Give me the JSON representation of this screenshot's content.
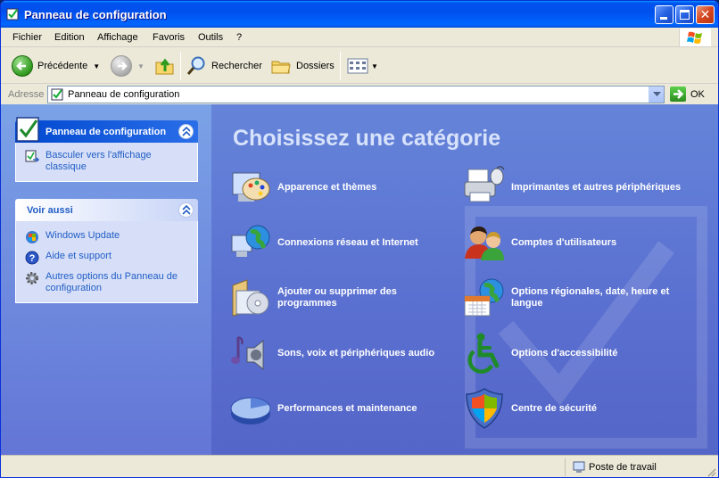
{
  "window": {
    "title": "Panneau de configuration",
    "title_icon": "control-panel-icon"
  },
  "menu": [
    {
      "label": "Fichier"
    },
    {
      "label": "Edition"
    },
    {
      "label": "Affichage"
    },
    {
      "label": "Favoris"
    },
    {
      "label": "Outils"
    },
    {
      "label": "?"
    }
  ],
  "toolbar": {
    "back_label": "Précédente",
    "search_label": "Rechercher",
    "folders_label": "Dossiers"
  },
  "address": {
    "label": "Adresse",
    "value": "Panneau de configuration",
    "go_label": "OK"
  },
  "sidebar": {
    "main_panel": {
      "title": "Panneau de configuration",
      "links": [
        {
          "label": "Basculer vers l'affichage classique",
          "icon": "switch-view-icon"
        }
      ]
    },
    "see_also_panel": {
      "title": "Voir aussi",
      "links": [
        {
          "label": "Windows Update",
          "icon": "windows-update-icon"
        },
        {
          "label": "Aide et support",
          "icon": "help-icon"
        },
        {
          "label": "Autres options du Panneau de configuration",
          "icon": "gear-icon"
        }
      ]
    }
  },
  "main": {
    "heading": "Choisissez une catégorie",
    "categories": [
      {
        "label": "Apparence et thèmes",
        "icon": "appearance-icon"
      },
      {
        "label": "Imprimantes et autres périphériques",
        "icon": "printer-icon"
      },
      {
        "label": "Connexions réseau et Internet",
        "icon": "network-icon"
      },
      {
        "label": "Comptes d'utilisateurs",
        "icon": "users-icon"
      },
      {
        "label": "Ajouter ou supprimer des programmes",
        "icon": "add-remove-programs-icon"
      },
      {
        "label": "Options régionales, date, heure et langue",
        "icon": "regional-options-icon"
      },
      {
        "label": "Sons, voix et périphériques audio",
        "icon": "sound-icon"
      },
      {
        "label": "Options d'accessibilité",
        "icon": "accessibility-icon"
      },
      {
        "label": "Performances et maintenance",
        "icon": "performance-icon"
      },
      {
        "label": "Centre de sécurité",
        "icon": "security-center-icon"
      }
    ]
  },
  "status": {
    "zone": "Poste de travail"
  },
  "colors": {
    "titlebar": "#0053ee",
    "sidebar_top": "#7ba2e7",
    "main_bg": "#6584d9",
    "link": "#215dc6",
    "panel_body": "#d6dff7"
  }
}
